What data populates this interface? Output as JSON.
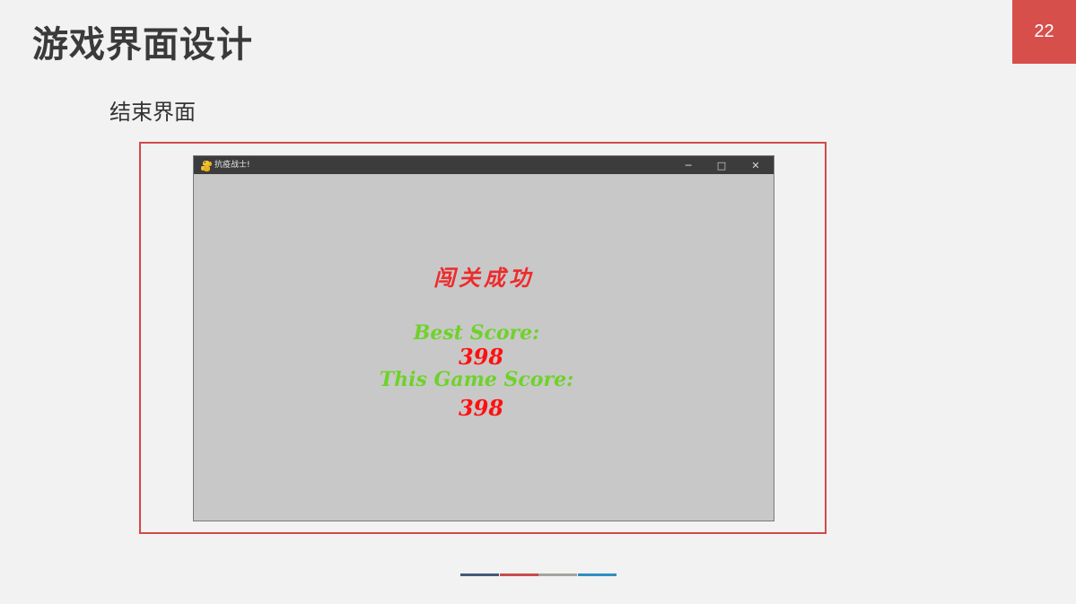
{
  "slide": {
    "title": "游戏界面设计",
    "page_number": "22",
    "subtitle": "结束界面"
  },
  "window": {
    "title": "抗疫战士!",
    "icon": "python-snake-icon",
    "controls": {
      "minimize": "─",
      "maximize": "□",
      "close": "✕"
    }
  },
  "game": {
    "status_text": "闯关成功",
    "best_label": "Best Score:",
    "best_value": "398",
    "this_label": "This Game Score:",
    "this_value": "398"
  },
  "colors": {
    "accent": "#d64f4b",
    "background": "#f2f2f2",
    "game_bg": "#c8c8c8",
    "status_red": "#ee2a2a",
    "label_green": "#6fd22a",
    "score_red": "#ff1010",
    "deco_bars": [
      "#435a78",
      "#c94c4c",
      "#a5a5a0",
      "#2e8fc4"
    ]
  }
}
